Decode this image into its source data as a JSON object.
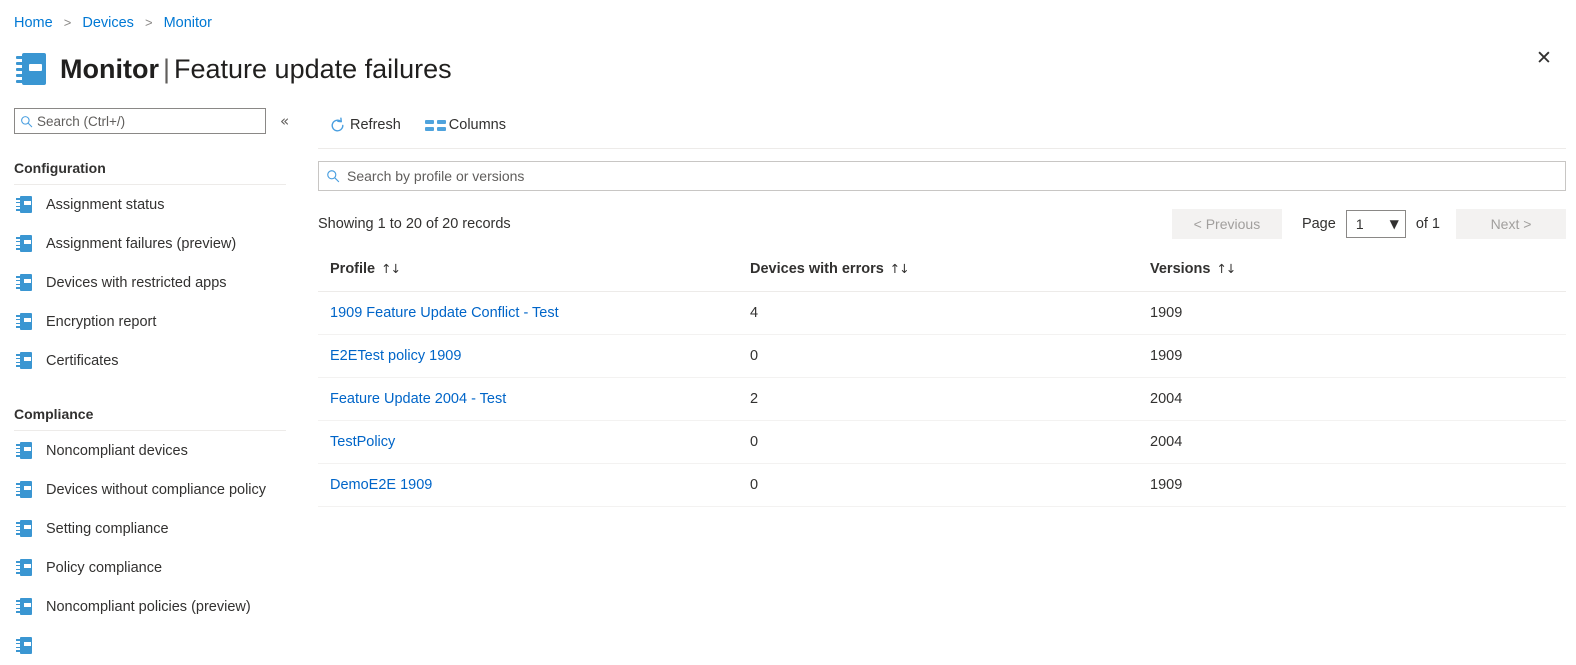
{
  "breadcrumb": {
    "items": [
      "Home",
      "Devices",
      "Monitor"
    ],
    "separator": ">"
  },
  "header": {
    "icon": "notebook-icon",
    "title_bold": "Monitor",
    "title_separator": "|",
    "title_rest": "Feature update failures",
    "close_icon": "close-icon"
  },
  "sidebar": {
    "search": {
      "icon": "search-icon",
      "placeholder": "Search (Ctrl+/)",
      "value": ""
    },
    "collapse_icon": "«",
    "groups": [
      {
        "title": "Configuration",
        "items": [
          "Assignment status",
          "Assignment failures (preview)",
          "Devices with restricted apps",
          "Encryption report",
          "Certificates"
        ]
      },
      {
        "title": "Compliance",
        "items": [
          "Noncompliant devices",
          "Devices without compliance policy",
          "Setting compliance",
          "Policy compliance",
          "Noncompliant policies (preview)"
        ]
      }
    ]
  },
  "toolbar": {
    "refresh_label": "Refresh",
    "refresh_icon": "refresh-icon",
    "columns_label": "Columns",
    "columns_icon": "columns-icon"
  },
  "search": {
    "icon": "search-icon",
    "placeholder": "Search by profile or versions",
    "value": ""
  },
  "pagination": {
    "records_text": "Showing 1 to 20 of 20 records",
    "previous_label": "< Previous",
    "page_label": "Page",
    "page_value": "1",
    "page_chevron": "chevron-down-icon",
    "of_label": "of 1",
    "next_label": "Next >"
  },
  "table": {
    "columns": [
      {
        "label": "Profile",
        "sort_icon": "↑↓"
      },
      {
        "label": "Devices with errors",
        "sort_icon": "↑↓"
      },
      {
        "label": "Versions",
        "sort_icon": "↑↓"
      }
    ],
    "rows": [
      {
        "profile": "1909 Feature Update Conflict - Test",
        "errors": "4",
        "version": "1909"
      },
      {
        "profile": "E2ETest policy 1909",
        "errors": "0",
        "version": "1909"
      },
      {
        "profile": "Feature Update 2004 - Test",
        "errors": "2",
        "version": "2004"
      },
      {
        "profile": "TestPolicy",
        "errors": "0",
        "version": "2004"
      },
      {
        "profile": "DemoE2E 1909",
        "errors": "0",
        "version": "1909"
      }
    ]
  },
  "colors": {
    "link": "#0078d4",
    "cell_link": "#0065c8",
    "icon_blue": "#3a96d2",
    "accent": "#0078d4"
  }
}
